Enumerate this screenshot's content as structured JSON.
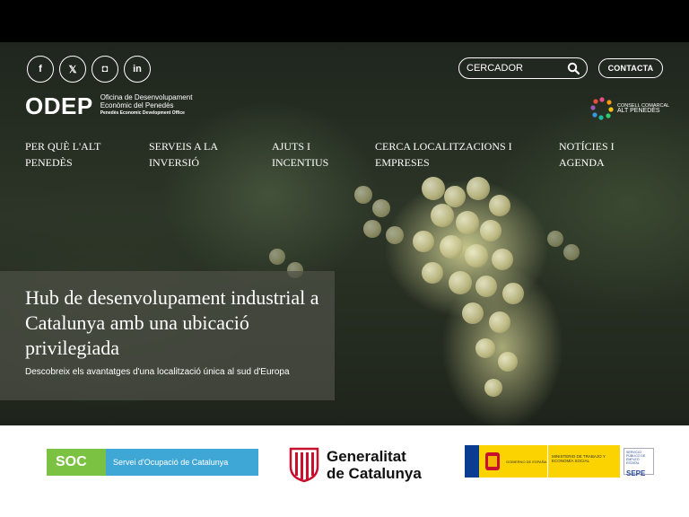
{
  "social": {
    "facebook": "f",
    "twitter": "𝕏",
    "instagram": "◘",
    "linkedin": "in"
  },
  "search": {
    "placeholder": "CERCADOR"
  },
  "contact_label": "CONTACTA",
  "logo": {
    "mark": "ODEP",
    "line1": "Oficina de Desenvolupament",
    "line2": "Econòmic del Penedès",
    "line3": "Penedès Economic Development Office"
  },
  "council": {
    "line1": "CONSELL COMARCAL",
    "line2": "ALT PENEDÈS"
  },
  "nav": [
    {
      "line1": "PER QUÈ L'ALT",
      "line2": "PENEDÈS"
    },
    {
      "line1": "SERVEIS A LA",
      "line2": "INVERSIÓ"
    },
    {
      "line1": "AJUTS I",
      "line2": "INCENTIUS"
    },
    {
      "line1": "CERCA LOCALITZACIONS I",
      "line2": "EMPRESES"
    },
    {
      "line1": "NOTÍCIES I",
      "line2": "AGENDA"
    }
  ],
  "hero": {
    "title": "Hub de desenvolupament industrial a Catalunya amb una ubicació privilegiada",
    "subtitle": "Descobreix els avantatges d'una localització única al sud d'Europa"
  },
  "footer": {
    "soc_mark": "SOC",
    "soc_text": "Servei d'Ocupació de Catalunya",
    "gen_line1": "Generalitat",
    "gen_line2": "de Catalunya",
    "gob_text": "GOBIERNO DE ESPAÑA",
    "min_text": "MINISTERIO DE TRABAJO Y ECONOMÍA SOCIAL",
    "sepe_small": "SERVICIO PÚBLICO DE EMPLEO ESTATAL",
    "sepe_mark": "SEPE"
  },
  "colors": {
    "soc_green": "#7cc242",
    "soc_blue": "#3fa7d6",
    "gov_yellow": "#fbd400",
    "gen_red": "#c8102e"
  }
}
